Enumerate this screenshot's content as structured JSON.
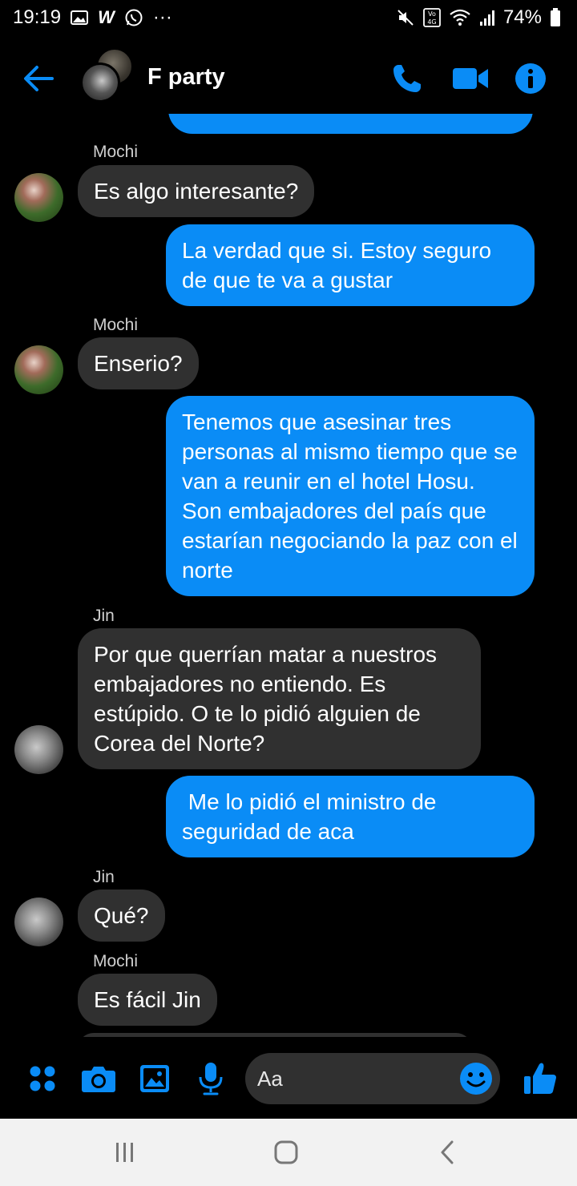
{
  "status_bar": {
    "time": "19:19",
    "more": "···",
    "battery_text": "74%",
    "network": "4G",
    "volte": "VoLTE"
  },
  "header": {
    "title": "F party",
    "accent_color": "#0a8cf6"
  },
  "messages": [
    {
      "type": "in",
      "sender": "Mochi",
      "text": "Es algo interesante?"
    },
    {
      "type": "out",
      "text": "La verdad que si. Estoy seguro de que te va a gustar"
    },
    {
      "type": "in",
      "sender": "Mochi",
      "text": "Enserio?"
    },
    {
      "type": "out",
      "text": "Tenemos que asesinar tres personas al mismo tiempo que se van a reunir en el hotel Hosu. Son embajadores del país que estarían negociando la paz con el norte"
    },
    {
      "type": "in",
      "sender": "Jin",
      "text": "Por que querrían matar a nuestros embajadores no entiendo. Es estúpido. O te lo pidió alguien de Corea del Norte?"
    },
    {
      "type": "out",
      "text": " Me lo pidió el ministro de seguridad de aca"
    },
    {
      "type": "in",
      "sender": "Jin",
      "text": "Qué?"
    },
    {
      "type": "in",
      "sender": "Mochi",
      "text": "Es fácil Jin"
    }
  ],
  "composer": {
    "placeholder": "Aa"
  },
  "icons": {
    "back": "arrow-left-icon",
    "call": "phone-icon",
    "video": "video-camera-icon",
    "info": "info-icon",
    "menu": "four-dots-icon",
    "camera": "camera-icon",
    "gallery": "image-icon",
    "mic": "microphone-icon",
    "emoji": "smiley-icon",
    "like": "thumbs-up-icon"
  }
}
